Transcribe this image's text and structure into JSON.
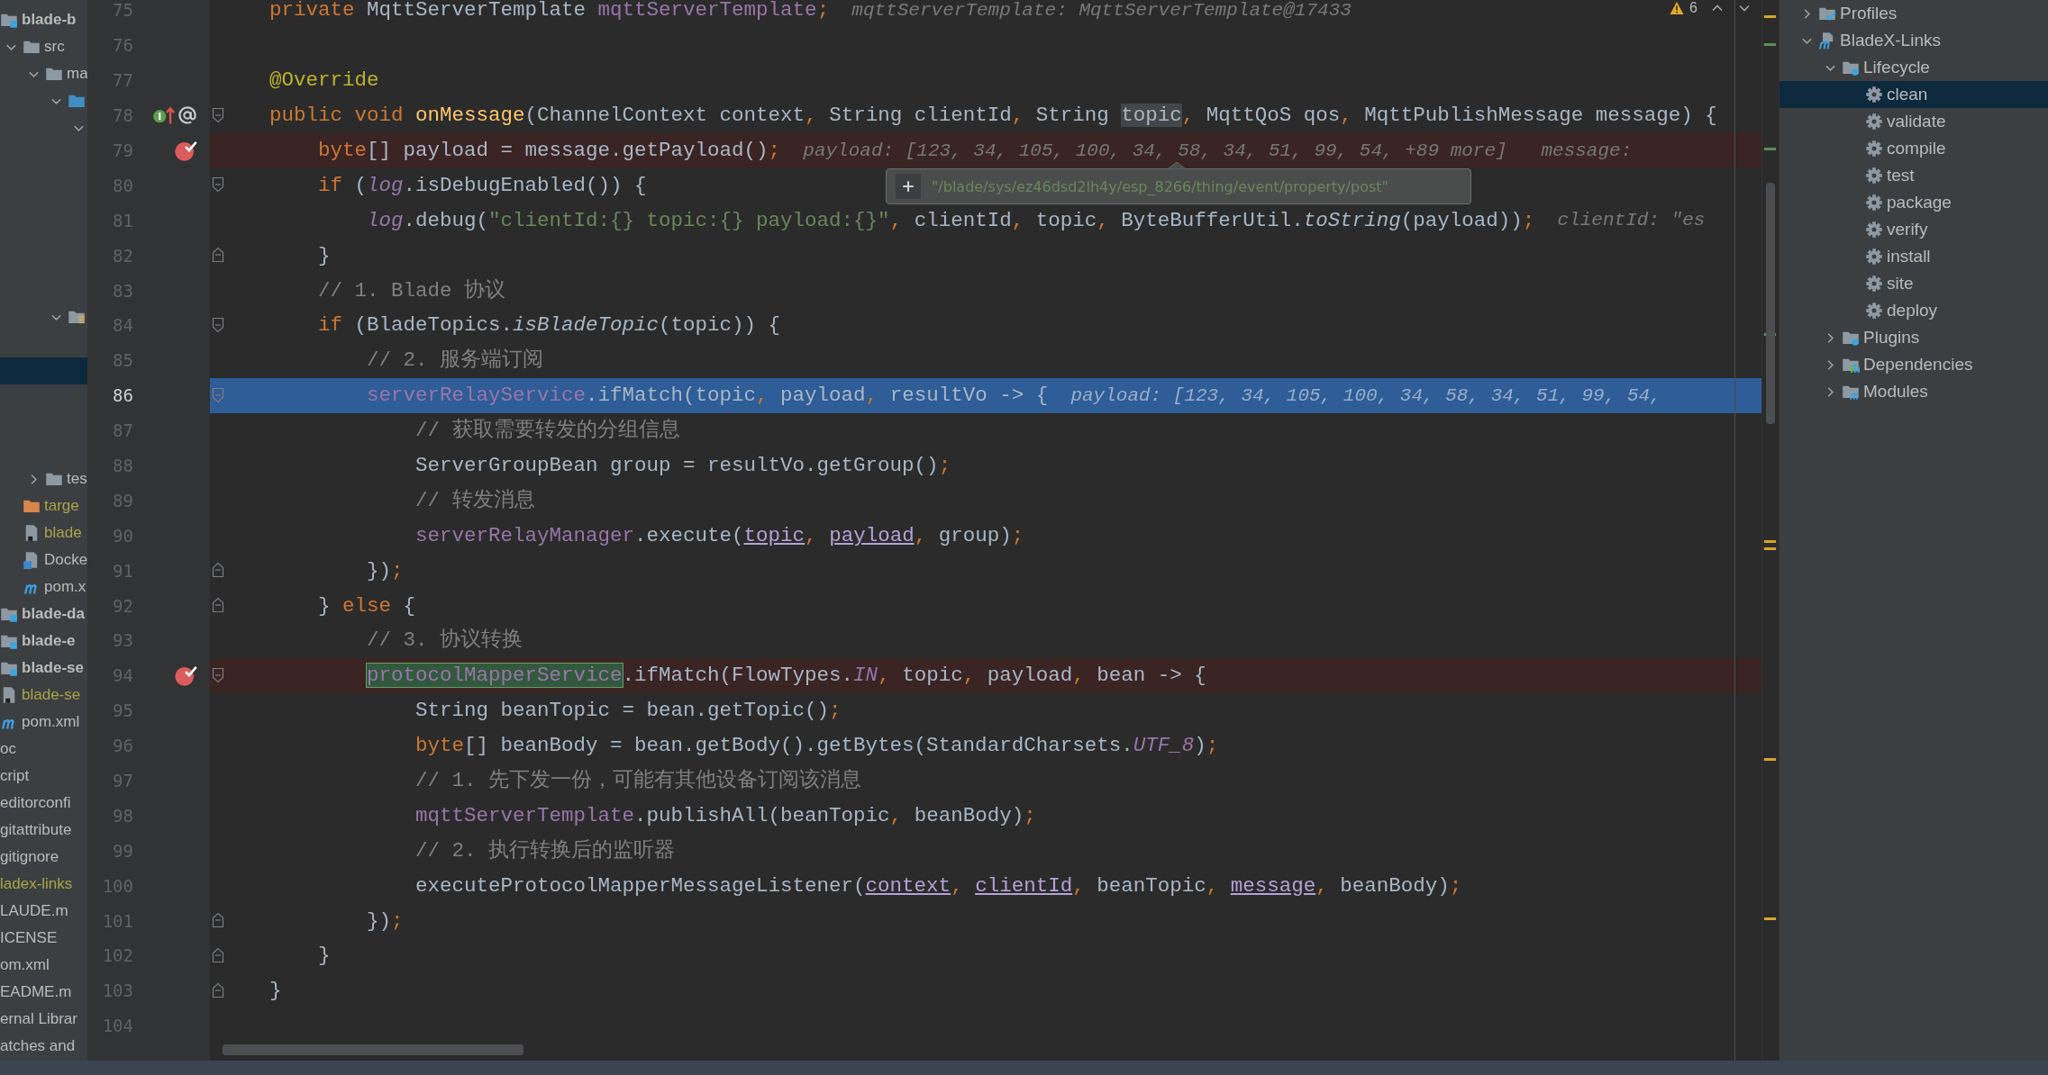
{
  "project_tree": {
    "items": [
      {
        "label": "blade-b",
        "kind": "module",
        "bold": true,
        "ignored": false,
        "selected": false,
        "children": [
          {
            "label": "src",
            "kind": "folder",
            "bold": false,
            "ignored": false,
            "expanded": true,
            "selected": false,
            "children": [
              {
                "label": "ma",
                "kind": "folder",
                "bold": false,
                "ignored": false,
                "expanded": true,
                "selected": false,
                "children": [
                  {
                    "kind": "source-folder",
                    "expanded": true,
                    "selected": false,
                    "children": [
                      {
                        "expanded": true,
                        "selected": false,
                        "children": [
                          {
                            "selected": false
                          },
                          {
                            "selected": false
                          },
                          {
                            "selected": false
                          },
                          {
                            "selected": false
                          },
                          {
                            "selected": false
                          },
                          {
                            "selected": false
                          }
                        ]
                      }
                    ]
                  },
                  {
                    "kind": "package",
                    "expanded": true,
                    "selected": false,
                    "children": [
                      {
                        "selected": false
                      },
                      {
                        "selected": true
                      },
                      {
                        "selected": false
                      },
                      {
                        "selected": false
                      },
                      {
                        "selected": false
                      }
                    ]
                  }
                ]
              },
              {
                "label": "tes",
                "kind": "folder",
                "bold": false,
                "ignored": false,
                "expanded": false,
                "selected": false
              }
            ]
          },
          {
            "label": "targe",
            "kind": "excluded-folder",
            "bold": false,
            "ignored": true,
            "selected": false
          },
          {
            "label": "blade",
            "kind": "file",
            "bold": false,
            "ignored": true,
            "selected": false
          },
          {
            "label": "Docke",
            "kind": "docker",
            "bold": false,
            "ignored": false,
            "selected": false
          },
          {
            "label": "pom.x",
            "kind": "maven",
            "bold": false,
            "ignored": false,
            "selected": false
          }
        ]
      },
      {
        "label": "blade-da",
        "kind": "module",
        "bold": true,
        "ignored": false,
        "selected": false
      },
      {
        "label": "blade-e",
        "kind": "module",
        "bold": true,
        "ignored": false,
        "selected": false
      },
      {
        "label": "blade-se",
        "kind": "module",
        "bold": true,
        "ignored": false,
        "selected": false
      },
      {
        "label": "blade-se",
        "kind": "file",
        "bold": false,
        "ignored": true,
        "selected": false
      },
      {
        "label": "pom.xml",
        "kind": "maven",
        "bold": false,
        "ignored": false,
        "selected": false
      },
      {
        "label": "oc",
        "bold": false,
        "ignored": false,
        "selected": false
      },
      {
        "label": "cript",
        "bold": false,
        "ignored": false,
        "selected": false
      },
      {
        "label": "editorconfi",
        "bold": false,
        "ignored": false,
        "selected": false
      },
      {
        "label": "gitattribute",
        "bold": false,
        "ignored": false,
        "selected": false
      },
      {
        "label": "gitignore",
        "bold": false,
        "ignored": false,
        "selected": false
      },
      {
        "label": "ladex-links",
        "bold": false,
        "ignored": true,
        "selected": false
      },
      {
        "label": "LAUDE.m",
        "bold": false,
        "ignored": false,
        "selected": false
      },
      {
        "label": "ICENSE",
        "bold": false,
        "ignored": false,
        "selected": false
      },
      {
        "label": "om.xml",
        "bold": false,
        "ignored": false,
        "selected": false
      },
      {
        "label": "EADME.m",
        "bold": false,
        "ignored": false,
        "selected": false
      },
      {
        "label": "ernal Librar",
        "bold": false,
        "ignored": false,
        "selected": false
      },
      {
        "label": "atches and",
        "bold": false,
        "ignored": false,
        "selected": false
      }
    ]
  },
  "editor": {
    "warnings": "6",
    "tooltip": {
      "text": "\"/blade/sys/ez46dsd2lh4y/esp_8266/thing/event/property/post\""
    },
    "lines": [
      {
        "number": "75",
        "breakpoint": false,
        "current": false,
        "tokens": [
          {
            "kind": "keyword",
            "text": "private "
          },
          {
            "kind": "plain",
            "text": "MqttServerTemplate "
          },
          {
            "kind": "field",
            "text": "mqttServerTemplate"
          },
          {
            "kind": "punct",
            "text": ";"
          }
        ],
        "hints": [
          "mqttServerTemplate: MqttServerTemplate@17433"
        ]
      },
      {
        "number": "76",
        "breakpoint": false,
        "current": false
      },
      {
        "number": "77",
        "breakpoint": false,
        "current": false,
        "tokens": [
          {
            "kind": "annotation",
            "text": "@Override"
          }
        ]
      },
      {
        "number": "78",
        "breakpoint": false,
        "current": false,
        "gutter_icons": [
          {
            "kind": "implementation"
          },
          {
            "kind": "at-sign"
          }
        ],
        "fold": {
          "kind": "start"
        },
        "tokens": [
          {
            "kind": "keyword",
            "text": "public void "
          },
          {
            "kind": "declaration",
            "text": "onMessage"
          },
          {
            "kind": "plain",
            "text": "(ChannelContext context"
          },
          {
            "kind": "punct",
            "text": ", "
          },
          {
            "kind": "plain",
            "text": "String clientId"
          },
          {
            "kind": "punct",
            "text": ", "
          },
          {
            "kind": "plain",
            "text": "String "
          },
          {
            "kind": "hovered",
            "text": "topic"
          },
          {
            "kind": "punct",
            "text": ", "
          },
          {
            "kind": "plain",
            "text": "MqttQoS qos"
          },
          {
            "kind": "punct",
            "text": ", "
          },
          {
            "kind": "plain",
            "text": "MqttPublishMessage message) {"
          }
        ],
        "children": [
          {
            "number": "79",
            "breakpoint": true,
            "current": false,
            "tokens": [
              {
                "kind": "keyword",
                "text": "byte"
              },
              {
                "kind": "plain",
                "text": "[] payload = message.getPayload()"
              },
              {
                "kind": "punct",
                "text": ";"
              }
            ],
            "hints": [
              "payload: [123, 34, 105, 100, 34, 58, 34, 51, 99, 54, +89 more]",
              "message:"
            ]
          },
          {
            "number": "80",
            "breakpoint": false,
            "current": false,
            "fold": {
              "kind": "start"
            },
            "tokens": [
              {
                "kind": "keyword",
                "text": "if "
              },
              {
                "kind": "plain",
                "text": "("
              },
              {
                "kind": "field-italic",
                "text": "log"
              },
              {
                "kind": "plain",
                "text": ".isDebugEnabled()) {"
              }
            ],
            "children": [
              {
                "number": "81",
                "breakpoint": false,
                "current": false,
                "tokens": [
                  {
                    "kind": "field-italic",
                    "text": "log"
                  },
                  {
                    "kind": "plain",
                    "text": ".debug("
                  },
                  {
                    "kind": "string",
                    "text": "\"clientId:{} topic:{} payload:{}\""
                  },
                  {
                    "kind": "punct",
                    "text": ", "
                  },
                  {
                    "kind": "plain",
                    "text": "clientId"
                  },
                  {
                    "kind": "punct",
                    "text": ", "
                  },
                  {
                    "kind": "plain",
                    "text": "topic"
                  },
                  {
                    "kind": "punct",
                    "text": ", "
                  },
                  {
                    "kind": "plain",
                    "text": "ByteBufferUtil."
                  },
                  {
                    "kind": "method-italic",
                    "text": "toString"
                  },
                  {
                    "kind": "plain",
                    "text": "(payload))"
                  },
                  {
                    "kind": "punct",
                    "text": ";"
                  }
                ],
                "hints": [
                  "clientId: \"es"
                ]
              }
            ]
          },
          {
            "number": "82",
            "breakpoint": false,
            "current": false,
            "fold": {
              "kind": "end"
            },
            "tokens": [
              {
                "kind": "plain",
                "text": "}"
              }
            ]
          },
          {
            "number": "83",
            "breakpoint": false,
            "current": false,
            "tokens": [
              {
                "kind": "comment",
                "text": "// 1. Blade 协议"
              }
            ]
          },
          {
            "number": "84",
            "breakpoint": false,
            "current": false,
            "fold": {
              "kind": "start"
            },
            "tokens": [
              {
                "kind": "keyword",
                "text": "if "
              },
              {
                "kind": "plain",
                "text": "(BladeTopics."
              },
              {
                "kind": "method-italic",
                "text": "isBladeTopic"
              },
              {
                "kind": "plain",
                "text": "(topic)) {"
              }
            ],
            "children": [
              {
                "number": "85",
                "breakpoint": false,
                "current": false,
                "tokens": [
                  {
                    "kind": "comment",
                    "text": "// 2. 服务端订阅"
                  }
                ]
              },
              {
                "number": "86",
                "breakpoint": false,
                "current": true,
                "fold": {
                  "kind": "start"
                },
                "tokens": [
                  {
                    "kind": "field",
                    "text": "serverRelayService"
                  },
                  {
                    "kind": "plain",
                    "text": ".ifMatch(topic"
                  },
                  {
                    "kind": "punct",
                    "text": ", "
                  },
                  {
                    "kind": "plain",
                    "text": "payload"
                  },
                  {
                    "kind": "punct",
                    "text": ", "
                  },
                  {
                    "kind": "plain",
                    "text": "resultVo -> {"
                  }
                ],
                "hints": [
                  "payload: [123, 34, 105, 100, 34, 58, 34, 51, 99, 54,"
                ],
                "children": [
                  {
                    "number": "87",
                    "breakpoint": false,
                    "current": false,
                    "tokens": [
                      {
                        "kind": "comment",
                        "text": "// 获取需要转发的分组信息"
                      }
                    ]
                  },
                  {
                    "number": "88",
                    "breakpoint": false,
                    "current": false,
                    "tokens": [
                      {
                        "kind": "plain",
                        "text": "ServerGroupBean group = resultVo.getGroup()"
                      },
                      {
                        "kind": "punct",
                        "text": ";"
                      }
                    ]
                  },
                  {
                    "number": "89",
                    "breakpoint": false,
                    "current": false,
                    "tokens": [
                      {
                        "kind": "comment",
                        "text": "// 转发消息"
                      }
                    ]
                  },
                  {
                    "number": "90",
                    "breakpoint": false,
                    "current": false,
                    "tokens": [
                      {
                        "kind": "field",
                        "text": "serverRelayManager"
                      },
                      {
                        "kind": "plain",
                        "text": ".execute("
                      },
                      {
                        "kind": "captured",
                        "text": "topic"
                      },
                      {
                        "kind": "punct",
                        "text": ", "
                      },
                      {
                        "kind": "captured",
                        "text": "payload"
                      },
                      {
                        "kind": "punct",
                        "text": ", "
                      },
                      {
                        "kind": "plain",
                        "text": "group)"
                      },
                      {
                        "kind": "punct",
                        "text": ";"
                      }
                    ]
                  }
                ]
              },
              {
                "number": "91",
                "breakpoint": false,
                "current": false,
                "fold": {
                  "kind": "end"
                },
                "tokens": [
                  {
                    "kind": "plain",
                    "text": "})"
                  },
                  {
                    "kind": "punct",
                    "text": ";"
                  }
                ]
              }
            ]
          },
          {
            "number": "92",
            "breakpoint": false,
            "current": false,
            "fold": {
              "kind": "end"
            },
            "tokens": [
              {
                "kind": "plain",
                "text": "} "
              },
              {
                "kind": "keyword",
                "text": "else "
              },
              {
                "kind": "plain",
                "text": "{"
              }
            ],
            "children": [
              {
                "number": "93",
                "breakpoint": false,
                "current": false,
                "tokens": [
                  {
                    "kind": "comment",
                    "text": "// 3. 协议转换"
                  }
                ]
              },
              {
                "number": "94",
                "breakpoint": true,
                "current": false,
                "fold": {
                  "kind": "start"
                },
                "tokens": [
                  {
                    "kind": "found",
                    "text": "protocolMapperService"
                  },
                  {
                    "kind": "plain",
                    "text": ".ifMatch(FlowTypes."
                  },
                  {
                    "kind": "static",
                    "text": "IN"
                  },
                  {
                    "kind": "punct",
                    "text": ", "
                  },
                  {
                    "kind": "plain",
                    "text": "topic"
                  },
                  {
                    "kind": "punct",
                    "text": ", "
                  },
                  {
                    "kind": "plain",
                    "text": "payload"
                  },
                  {
                    "kind": "punct",
                    "text": ", "
                  },
                  {
                    "kind": "plain",
                    "text": "bean -> {"
                  }
                ],
                "children": [
                  {
                    "number": "95",
                    "breakpoint": false,
                    "current": false,
                    "tokens": [
                      {
                        "kind": "plain",
                        "text": "String beanTopic = bean.getTopic()"
                      },
                      {
                        "kind": "punct",
                        "text": ";"
                      }
                    ]
                  },
                  {
                    "number": "96",
                    "breakpoint": false,
                    "current": false,
                    "tokens": [
                      {
                        "kind": "keyword",
                        "text": "byte"
                      },
                      {
                        "kind": "plain",
                        "text": "[] beanBody = bean.getBody().getBytes(StandardCharsets."
                      },
                      {
                        "kind": "static",
                        "text": "UTF_8"
                      },
                      {
                        "kind": "plain",
                        "text": ")"
                      },
                      {
                        "kind": "punct",
                        "text": ";"
                      }
                    ]
                  },
                  {
                    "number": "97",
                    "breakpoint": false,
                    "current": false,
                    "tokens": [
                      {
                        "kind": "comment",
                        "text": "// 1. 先下发一份，可能有其他设备订阅该消息"
                      }
                    ]
                  },
                  {
                    "number": "98",
                    "breakpoint": false,
                    "current": false,
                    "tokens": [
                      {
                        "kind": "field",
                        "text": "mqttServerTemplate"
                      },
                      {
                        "kind": "plain",
                        "text": ".publishAll(beanTopic"
                      },
                      {
                        "kind": "punct",
                        "text": ", "
                      },
                      {
                        "kind": "plain",
                        "text": "beanBody)"
                      },
                      {
                        "kind": "punct",
                        "text": ";"
                      }
                    ]
                  },
                  {
                    "number": "99",
                    "breakpoint": false,
                    "current": false,
                    "tokens": [
                      {
                        "kind": "comment",
                        "text": "// 2. 执行转换后的监听器"
                      }
                    ]
                  },
                  {
                    "number": "100",
                    "breakpoint": false,
                    "current": false,
                    "tokens": [
                      {
                        "kind": "plain",
                        "text": "executeProtocolMapperMessageListener("
                      },
                      {
                        "kind": "captured",
                        "text": "context"
                      },
                      {
                        "kind": "punct",
                        "text": ", "
                      },
                      {
                        "kind": "captured",
                        "text": "clientId"
                      },
                      {
                        "kind": "punct",
                        "text": ", "
                      },
                      {
                        "kind": "plain",
                        "text": "beanTopic"
                      },
                      {
                        "kind": "punct",
                        "text": ", "
                      },
                      {
                        "kind": "captured",
                        "text": "message"
                      },
                      {
                        "kind": "punct",
                        "text": ", "
                      },
                      {
                        "kind": "plain",
                        "text": "beanBody)"
                      },
                      {
                        "kind": "punct",
                        "text": ";"
                      }
                    ]
                  }
                ]
              },
              {
                "number": "101",
                "breakpoint": false,
                "current": false,
                "fold": {
                  "kind": "end"
                },
                "tokens": [
                  {
                    "kind": "plain",
                    "text": "})"
                  },
                  {
                    "kind": "punct",
                    "text": ";"
                  }
                ]
              }
            ]
          },
          {
            "number": "102",
            "breakpoint": false,
            "current": false,
            "fold": {
              "kind": "end"
            },
            "tokens": [
              {
                "kind": "plain",
                "text": "}"
              }
            ]
          }
        ]
      },
      {
        "number": "103",
        "breakpoint": false,
        "current": false,
        "fold": {
          "kind": "end"
        },
        "tokens": [
          {
            "kind": "plain",
            "text": "}"
          }
        ]
      },
      {
        "number": "104",
        "breakpoint": false,
        "current": false
      }
    ]
  },
  "maven_panel": {
    "items": [
      {
        "label": "Profiles",
        "kind": "profiles",
        "expanded": false,
        "selected": false
      },
      {
        "label": "BladeX-Links",
        "kind": "project",
        "expanded": true,
        "selected": false,
        "children": [
          {
            "label": "Lifecycle",
            "kind": "lifecycle",
            "expanded": true,
            "selected": false,
            "children": [
              {
                "label": "clean",
                "kind": "goal",
                "selected": true
              },
              {
                "label": "validate",
                "kind": "goal",
                "selected": false
              },
              {
                "label": "compile",
                "kind": "goal",
                "selected": false
              },
              {
                "label": "test",
                "kind": "goal",
                "selected": false
              },
              {
                "label": "package",
                "kind": "goal",
                "selected": false
              },
              {
                "label": "verify",
                "kind": "goal",
                "selected": false
              },
              {
                "label": "install",
                "kind": "goal",
                "selected": false
              },
              {
                "label": "site",
                "kind": "goal",
                "selected": false
              },
              {
                "label": "deploy",
                "kind": "goal",
                "selected": false
              }
            ]
          },
          {
            "label": "Plugins",
            "kind": "plugins",
            "expanded": false,
            "selected": false
          },
          {
            "label": "Dependencies",
            "kind": "dependencies",
            "expanded": false,
            "selected": false
          },
          {
            "label": "Modules",
            "kind": "modules",
            "expanded": false,
            "selected": false
          }
        ]
      }
    ]
  }
}
